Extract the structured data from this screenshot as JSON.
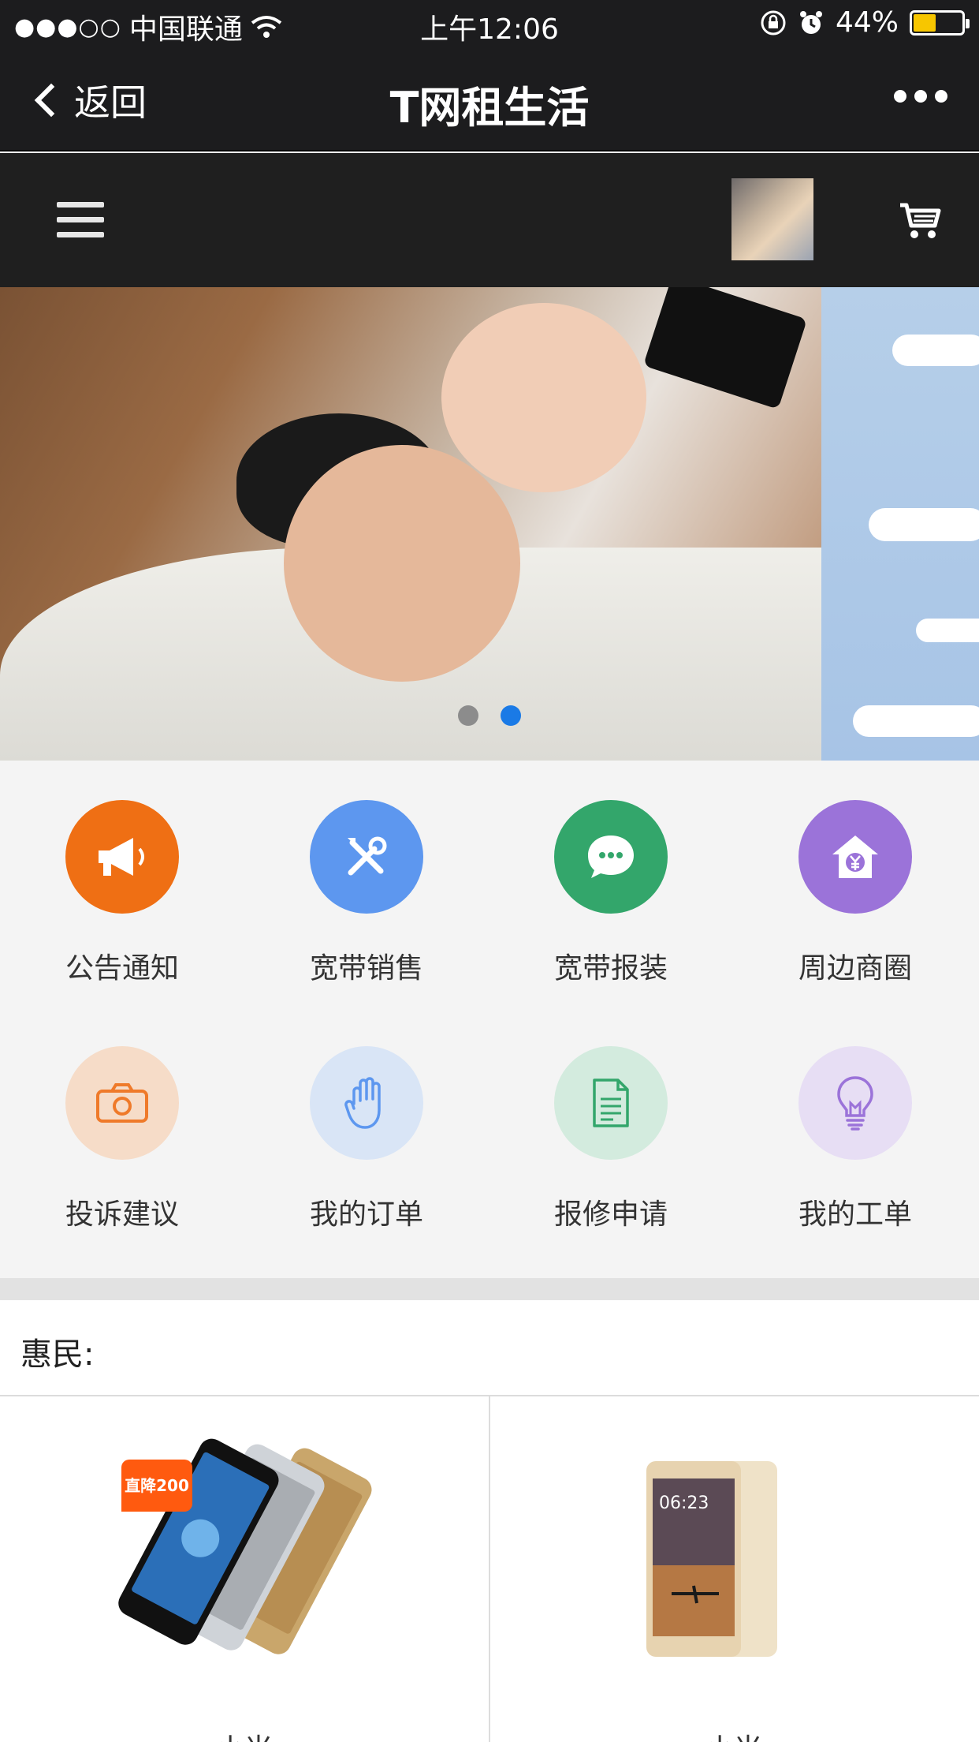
{
  "status_bar": {
    "signal": "●●●○○",
    "carrier": "中国联通",
    "time": "上午12:06",
    "battery_percent": "44%",
    "battery_level": 0.44
  },
  "nav": {
    "back_label": "返回",
    "title": "T网租生活"
  },
  "banner": {
    "active_index": 1,
    "dots": [
      {
        "color": "#8c8c8c"
      },
      {
        "color": "#1a7ae6"
      }
    ]
  },
  "services": [
    {
      "label": "公告通知",
      "icon": "megaphone-icon",
      "bg": "#ef6f14",
      "fg": "#ffffff"
    },
    {
      "label": "宽带销售",
      "icon": "tools-icon",
      "bg": "#5d97ef",
      "fg": "#ffffff"
    },
    {
      "label": "宽带报装",
      "icon": "chat-icon",
      "bg": "#33a66b",
      "fg": "#ffffff"
    },
    {
      "label": "周边商圈",
      "icon": "home-yen-icon",
      "bg": "#9b73d9",
      "fg": "#ffffff"
    },
    {
      "label": "投诉建议",
      "icon": "camera-icon",
      "bg": "#f6dcc8",
      "fg": "#ef7a2a"
    },
    {
      "label": "我的订单",
      "icon": "hand-icon",
      "bg": "#d9e5f6",
      "fg": "#5d97ef"
    },
    {
      "label": "报修申请",
      "icon": "document-icon",
      "bg": "#d3ebde",
      "fg": "#33a66b"
    },
    {
      "label": "我的工单",
      "icon": "lightbulb-icon",
      "bg": "#e7def4",
      "fg": "#9b73d9"
    }
  ],
  "section": {
    "title": "惠民:"
  },
  "products": [
    {
      "badge": "直降200",
      "label": "小米"
    },
    {
      "label": "小米"
    }
  ]
}
